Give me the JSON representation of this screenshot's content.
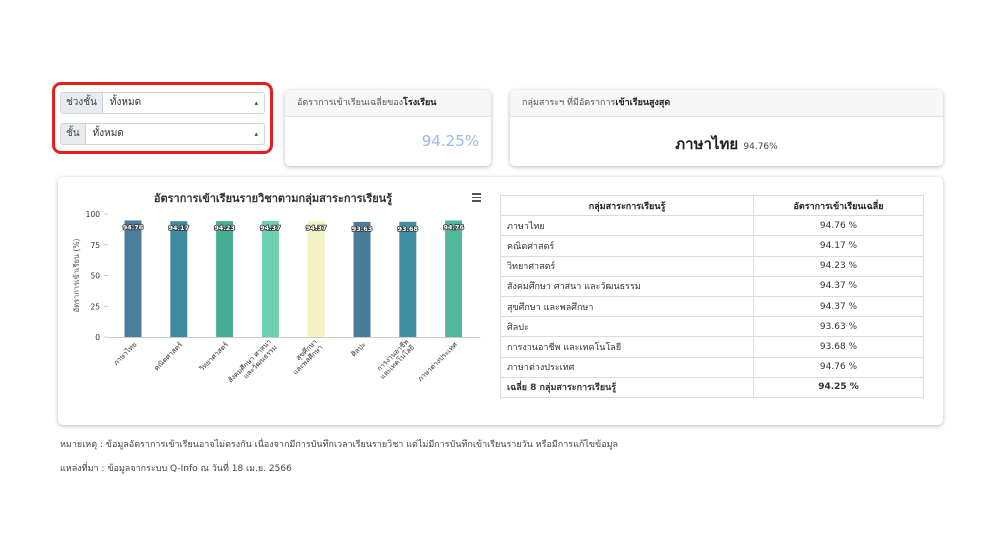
{
  "filters": {
    "level_label": "ช่วงชั้น",
    "level_value": "ทั้งหมด",
    "grade_label": "ชั้น",
    "grade_value": "ทั้งหมด"
  },
  "school_card": {
    "title_prefix": "อัตราการเข้าเรียนเฉลี่ยของ",
    "title_bold": "โรงเรียน",
    "value": "94.25%"
  },
  "top_group_card": {
    "title_prefix": "กลุ่มสาระฯ ที่มีอัตราการ",
    "title_bold": "เข้าเรียนสูงสุด",
    "group": "ภาษาไทย",
    "value": "94.76%"
  },
  "chart_data": {
    "type": "bar",
    "title": "อัตราการเข้าเรียนรายวิชาตามกลุ่มสาระการเรียนรู้",
    "ylabel": "อัตราการเข้าเรียน (%)",
    "xlabel": "",
    "ylim": [
      0,
      100
    ],
    "yticks": [
      0,
      25,
      50,
      75,
      100
    ],
    "categories": [
      [
        "ภาษาไทย"
      ],
      [
        "คณิตศาสตร์"
      ],
      [
        "วิทยาศาสตร์"
      ],
      [
        "สังคมศึกษา ศาสนา",
        "และวัฒนธรรม"
      ],
      [
        "สุขศึกษา",
        "และพลศึกษา"
      ],
      [
        "ศิลปะ"
      ],
      [
        "การงานอาชีพ",
        "และเทคโนโลยี"
      ],
      [
        "ภาษาต่างประเทศ"
      ]
    ],
    "values": [
      94.76,
      94.17,
      94.23,
      94.37,
      94.37,
      93.63,
      93.68,
      94.76
    ],
    "colors": [
      "#4c7d9b",
      "#3e8a9e",
      "#49ae95",
      "#6dcfb1",
      "#f2f2c5",
      "#4a7c9a",
      "#3f8ea2",
      "#52b79c"
    ],
    "data_labels": [
      "94.76",
      "94.17",
      "94.23",
      "94.37",
      "94.37",
      "93.63",
      "93.68",
      "94.76"
    ],
    "grid": false,
    "legend": "none"
  },
  "table": {
    "headers": [
      "กลุ่มสาระการเรียนรู้",
      "อัตราการเข้าเรียนเฉลี่ย"
    ],
    "rows": [
      {
        "name": "ภาษาไทย",
        "value": "94.76 %"
      },
      {
        "name": "คณิตศาสตร์",
        "value": "94.17 %"
      },
      {
        "name": "วิทยาศาสตร์",
        "value": "94.23 %"
      },
      {
        "name": "สังคมศึกษา ศาสนา และวัฒนธรรม",
        "value": "94.37 %"
      },
      {
        "name": "สุขศึกษา และพลศึกษา",
        "value": "94.37 %"
      },
      {
        "name": "ศิลปะ",
        "value": "93.63 %"
      },
      {
        "name": "การงานอาชีพ และเทคโนโลยี",
        "value": "93.68 %"
      },
      {
        "name": "ภาษาต่างประเทศ",
        "value": "94.76 %"
      }
    ],
    "average": {
      "name": "เฉลี่ย 8 กลุ่มสาระการเรียนรู้",
      "value": "94.25 %"
    }
  },
  "notes": {
    "remark": "หมายเหตุ : ข้อมูลอัตราการเข้าเรียนอาจไม่ตรงกัน เนื่องจากมีการบันทึกเวลาเรียนรายวิชา แต่ไม่มีการบันทึกเข้าเรียนรายวัน หรือมีการแก้ไขข้อมูล",
    "source": "แหล่งที่มา : ข้อมูลจากระบบ Q-Info ณ วันที่ 18 เม.ย. 2566"
  },
  "icons": {
    "select_arrow": "updown-chevron-icon",
    "chart_menu": "hamburger-menu-icon"
  },
  "colors": {
    "highlight": "#e21f1f",
    "stat_value": "#9bb6ef"
  }
}
